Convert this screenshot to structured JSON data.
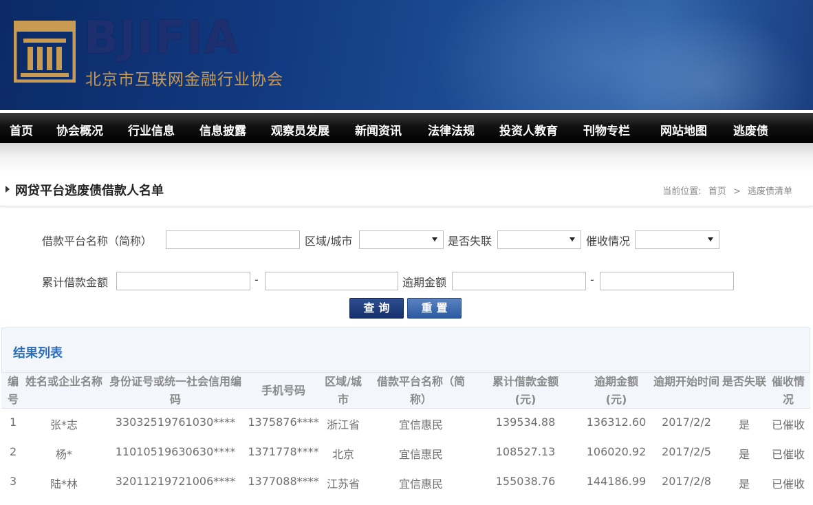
{
  "brand": {
    "title": "BJIFIA",
    "subtitle": "北京市互联网金融行业协会",
    "gold": "#c89a52",
    "navy": "#1d2f6f"
  },
  "nav": {
    "items": [
      "首页",
      "协会概况",
      "行业信息",
      "信息披露",
      "观察员发展",
      "新闻资讯",
      "法律法规",
      "投资人教育",
      "刊物专栏",
      "网站地图",
      "逃废债"
    ]
  },
  "page": {
    "title": "网贷平台逃废债借款人名单",
    "breadcrumb_label": "当前位置:",
    "breadcrumb_home": "首页",
    "breadcrumb_sep": ">",
    "breadcrumb_current": "逃废债清单"
  },
  "form": {
    "platform_label": "借款平台名称（简称）",
    "platform_value": "",
    "region_label": "区域/城市",
    "region_value": "",
    "lost_label": "是否失联",
    "lost_value": "",
    "collection_label": "催收情况",
    "collection_value": "",
    "borrow_amount_label": "累计借款金额",
    "borrow_min": "",
    "borrow_max": "",
    "range_sep": "-",
    "overdue_amount_label": "逾期金额",
    "overdue_min": "",
    "overdue_max": "",
    "search_button": "查询",
    "reset_button": "重置"
  },
  "results": {
    "heading": "结果列表",
    "heading_color": "#2d6eb8",
    "columns": [
      "编号",
      "姓名或企业名称",
      "身份证号或统一社会信用编码",
      "手机号码",
      "区域/城市",
      "借款平台名称（简称）",
      "累计借款金额(元)",
      "逾期金额(元)",
      "逾期开始时间",
      "是否失联",
      "催收情况"
    ],
    "rows": [
      [
        "1",
        "张*志",
        "33032519761030****",
        "1375876****",
        "浙江省",
        "宜信惠民",
        "139534.88",
        "136312.60",
        "2017/2/2",
        "是",
        "已催收"
      ],
      [
        "2",
        "杨*",
        "11010519630630****",
        "1371778****",
        "北京",
        "宜信惠民",
        "108527.13",
        "106020.92",
        "2017/2/5",
        "是",
        "已催收"
      ],
      [
        "3",
        "陆*林",
        "32011219721006****",
        "1377088****",
        "江苏省",
        "宜信惠民",
        "155038.76",
        "144186.99",
        "2017/2/8",
        "是",
        "已催收"
      ]
    ]
  }
}
